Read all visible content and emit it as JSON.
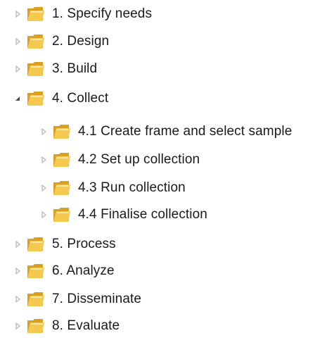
{
  "tree": {
    "items": [
      {
        "label": "1. Specify needs",
        "level": 0,
        "expanded": false,
        "icon": "folder-icon"
      },
      {
        "label": "2. Design",
        "level": 0,
        "expanded": false,
        "icon": "folder-icon"
      },
      {
        "label": "3. Build",
        "level": 0,
        "expanded": false,
        "icon": "folder-icon"
      },
      {
        "label": "4. Collect",
        "level": 0,
        "expanded": true,
        "icon": "folder-icon"
      },
      {
        "label": "4.1 Create frame and select sample",
        "level": 1,
        "expanded": false,
        "icon": "folder-icon"
      },
      {
        "label": "4.2 Set up collection",
        "level": 1,
        "expanded": false,
        "icon": "folder-icon"
      },
      {
        "label": "4.3 Run collection",
        "level": 1,
        "expanded": false,
        "icon": "folder-icon"
      },
      {
        "label": "4.4 Finalise collection",
        "level": 1,
        "expanded": false,
        "icon": "folder-icon"
      },
      {
        "label": "5. Process",
        "level": 0,
        "expanded": false,
        "icon": "folder-icon"
      },
      {
        "label": "6. Analyze",
        "level": 0,
        "expanded": false,
        "icon": "folder-icon"
      },
      {
        "label": "7. Disseminate",
        "level": 0,
        "expanded": false,
        "icon": "folder-icon"
      },
      {
        "label": "8. Evaluate",
        "level": 0,
        "expanded": false,
        "icon": "folder-icon"
      }
    ]
  },
  "colors": {
    "folder_back": "#d9a021",
    "folder_front": "#f4c94d",
    "folder_highlight": "#fbe7a1",
    "expander_collapsed": "#b5b5b5",
    "expander_expanded": "#4a4a4a",
    "text": "#1a1a1a"
  }
}
